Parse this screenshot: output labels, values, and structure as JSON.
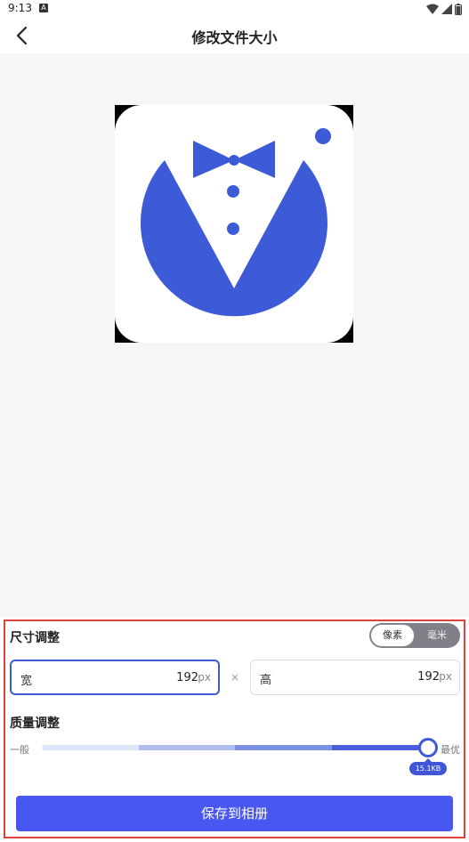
{
  "status_bar": {
    "time": "9:13",
    "notification_letter": "A"
  },
  "header": {
    "title": "修改文件大小",
    "back_icon": "chevron-left-icon"
  },
  "preview": {
    "image": "bow-tie-app-logo"
  },
  "size_section": {
    "title": "尺寸调整",
    "unit_options": [
      "像素",
      "毫米"
    ],
    "selected_unit": "像素",
    "width": {
      "label": "宽",
      "value": "192",
      "unit": "px"
    },
    "height": {
      "label": "高",
      "value": "192",
      "unit": "px"
    },
    "separator": "×"
  },
  "quality_section": {
    "title": "质量调整",
    "min_label": "一般",
    "max_label": "最优",
    "level": 1.0,
    "file_size": "15.1KB"
  },
  "save_button": {
    "label": "保存到相册"
  },
  "colors": {
    "accent": "#4757f0",
    "highlight_border": "#e2403b",
    "logo_blue": "#3d5bd6"
  }
}
